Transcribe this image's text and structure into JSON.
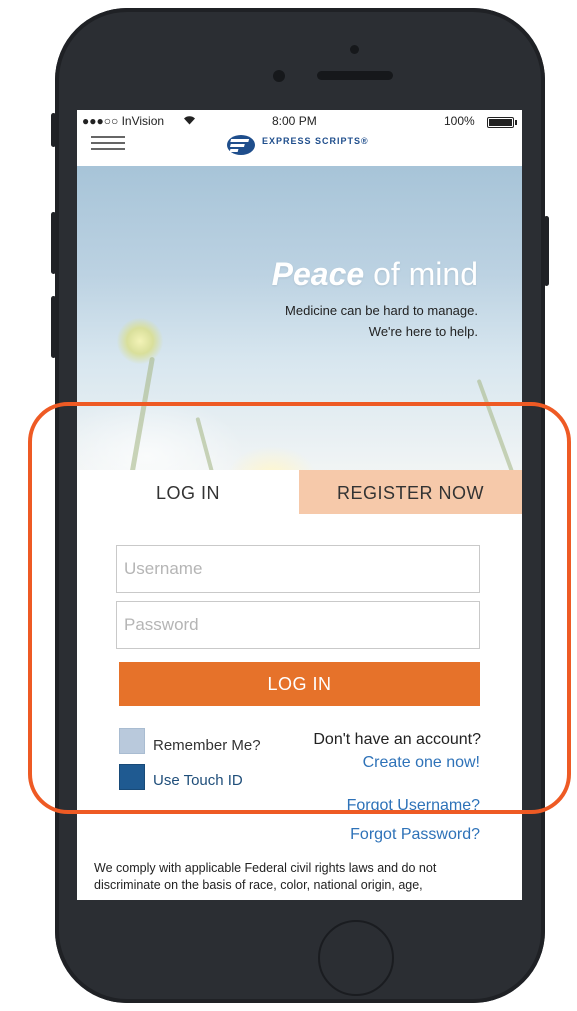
{
  "status_bar": {
    "carrier": "●●●○○ InVision",
    "wifi_icon": "wifi-icon",
    "time": "8:00 PM",
    "battery": "100%"
  },
  "header": {
    "menu_icon": "hamburger-menu-icon",
    "brand": "EXPRESS SCRIPTS®",
    "brand_color": "#1f4e8c"
  },
  "hero": {
    "title_bold": "Peace",
    "title_rest": " of mind",
    "subtitle_line1": "Medicine can be hard to manage.",
    "subtitle_line2": "We're here to help."
  },
  "tabs": [
    {
      "label": "LOG IN",
      "active": true
    },
    {
      "label": "REGISTER NOW",
      "active": false
    }
  ],
  "form": {
    "username_placeholder": "Username",
    "username_value": "",
    "password_placeholder": "Password",
    "password_value": "",
    "login_button": "LOG IN",
    "remember_me": {
      "label": "Remember Me?",
      "checked": false
    },
    "touch_id": {
      "label": "Use Touch ID",
      "checked": true
    },
    "account_question": "Don't have an account?",
    "create_link": "Create one now!",
    "forgot_username": "Forgot Username?",
    "forgot_password": "Forgot Password?"
  },
  "legal": "We comply with applicable Federal civil rights laws and do not discriminate on the basis of race, color, national origin, age,",
  "colors": {
    "accent": "#e6722a",
    "register_tab": "#f6c9aa",
    "link": "#2e72b8",
    "highlight": "#ee5a24",
    "phone_body": "#2b2e33"
  }
}
